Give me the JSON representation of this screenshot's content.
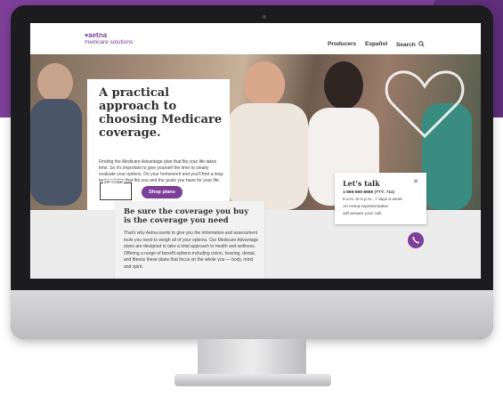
{
  "nav": {
    "logo_main": "aetna",
    "logo_sub": "medicare solutions",
    "items": [
      {
        "label": "Producers"
      },
      {
        "label": "Español"
      },
      {
        "label": "Search"
      }
    ],
    "search_icon": "search-icon"
  },
  "hero": {
    "title": "A practical approach to choosing Medicare coverage.",
    "body": "Finding the Medicare Advantage plan that fits your life takes time. So it's important to give yourself the time to clearly evaluate your options. Do your homework and you'll find a long-term solution that fits you and the goals you have for your life.",
    "zip_label": "ZIP CODE",
    "shop_button": "Shop plans",
    "heart_icon": "heart-outline-icon"
  },
  "coverage": {
    "title": "Be sure the coverage you buy is the coverage you need",
    "body": "That's why Aetna wants to give you the information and assessment tools you need to weigh all of your options. Our Medicare Advantage plans are designed to take a total approach to health and wellness. Offering a range of benefit options including vision, hearing, dental, and fitness these plans that focus on the whole you — body, mind and spirit."
  },
  "talk": {
    "title": "Let's talk",
    "close_icon": "close-icon",
    "phone": "1-888-888-8888 (TTY: 711)",
    "hours": "8 a.m. to 8 p.m., 7 days a week.",
    "line2": "An Aetna representative",
    "line3": "will answer your call.",
    "call_icon": "phone-icon"
  },
  "colors": {
    "brand_purple": "#7d3f98",
    "background_purple": "#7d3f98",
    "background_purple_dark": "#5e2e78"
  }
}
